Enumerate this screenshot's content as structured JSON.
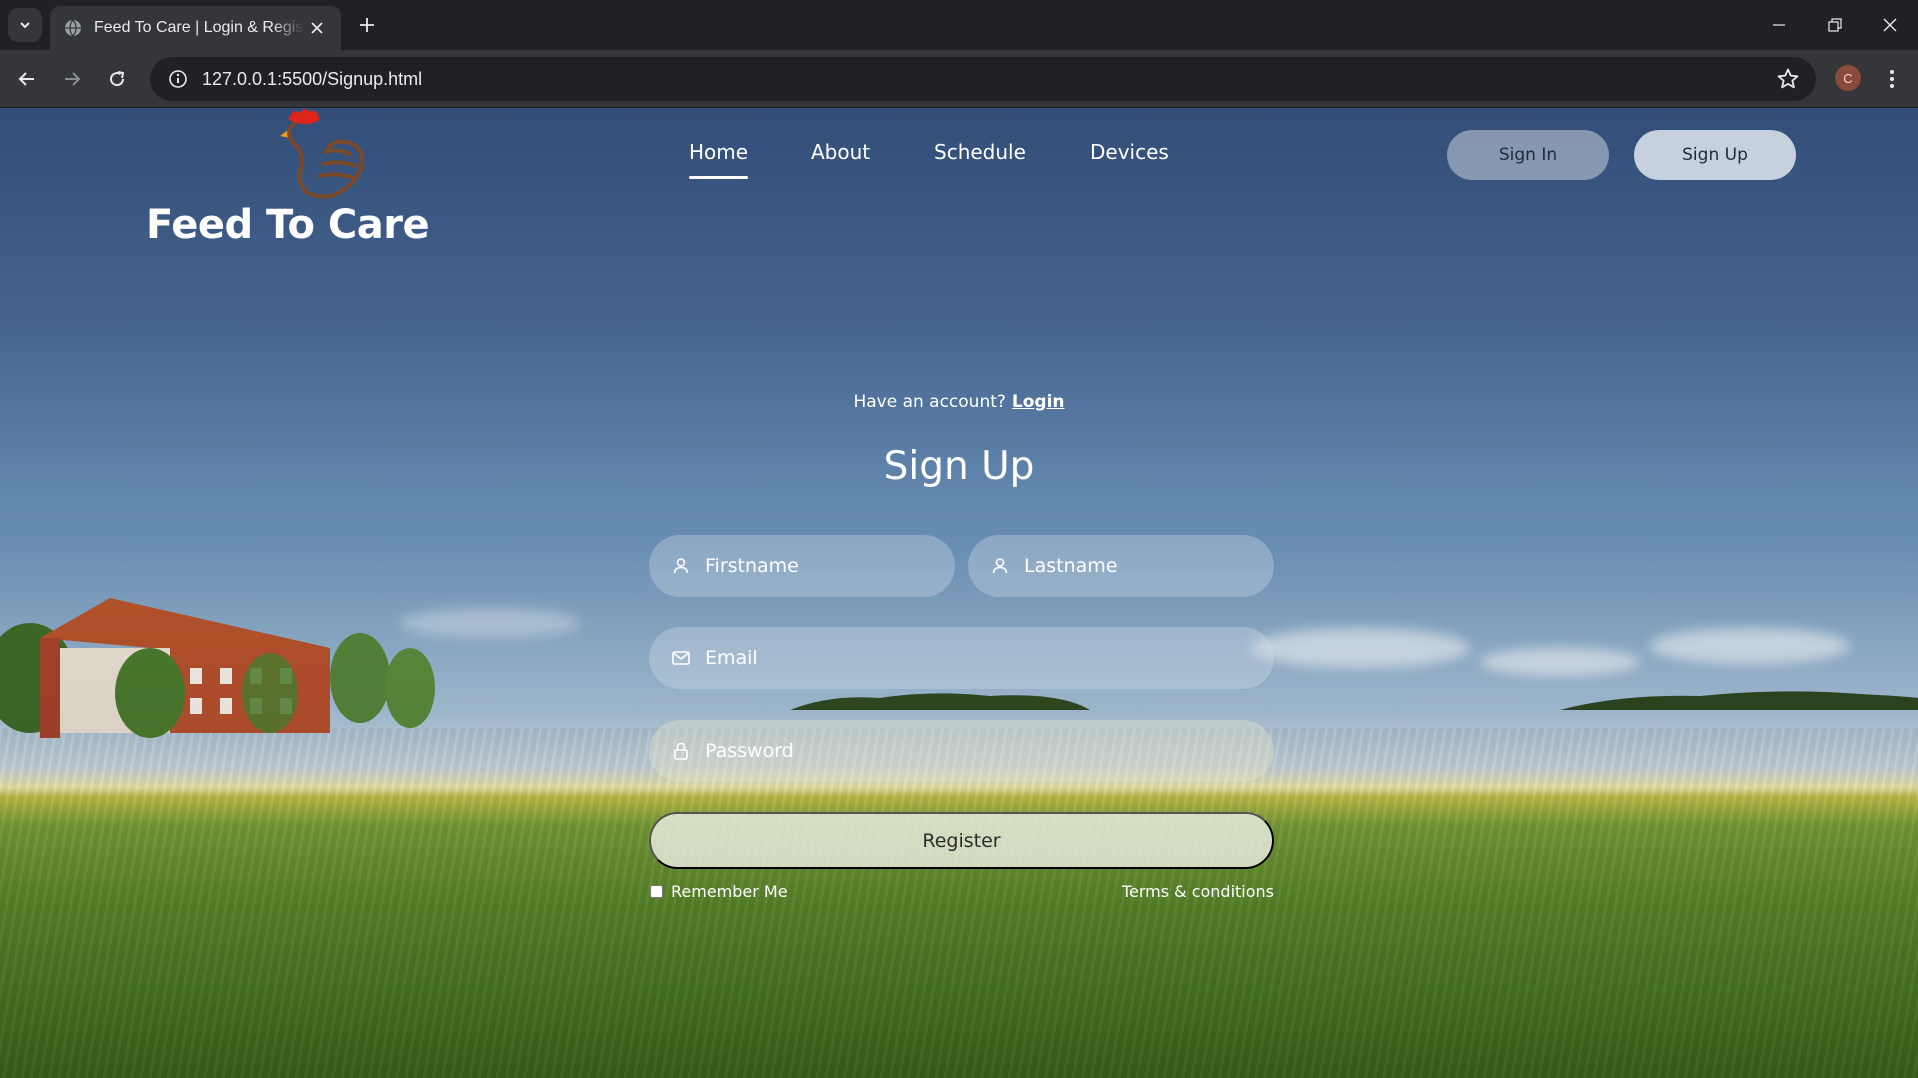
{
  "browser": {
    "tab_title": "Feed To Care | Login & Registration",
    "url": "127.0.0.1:5500/Signup.html",
    "profile_initial": "C"
  },
  "site": {
    "brand": "Feed To Care",
    "nav": [
      "Home",
      "About",
      "Schedule",
      "Devices"
    ],
    "active_nav": "Home",
    "sign_in_label": "Sign In",
    "sign_up_label": "Sign Up"
  },
  "form": {
    "have_account_text": "Have an account?",
    "login_link": "Login",
    "title": "Sign Up",
    "firstname_placeholder": "Firstname",
    "lastname_placeholder": "Lastname",
    "email_placeholder": "Email",
    "password_placeholder": "Password",
    "register_label": "Register",
    "remember_label": "Remember Me",
    "terms_label": "Terms & conditions"
  },
  "icons": {
    "tab": "globe-icon",
    "fields": [
      "user-icon",
      "user-icon",
      "mail-icon",
      "lock-icon"
    ]
  },
  "colors": {
    "browser_bg": "#202124",
    "toolbar_bg": "#35363a",
    "logo_comb": "#e0241b",
    "logo_body": "#7a4a2a"
  }
}
